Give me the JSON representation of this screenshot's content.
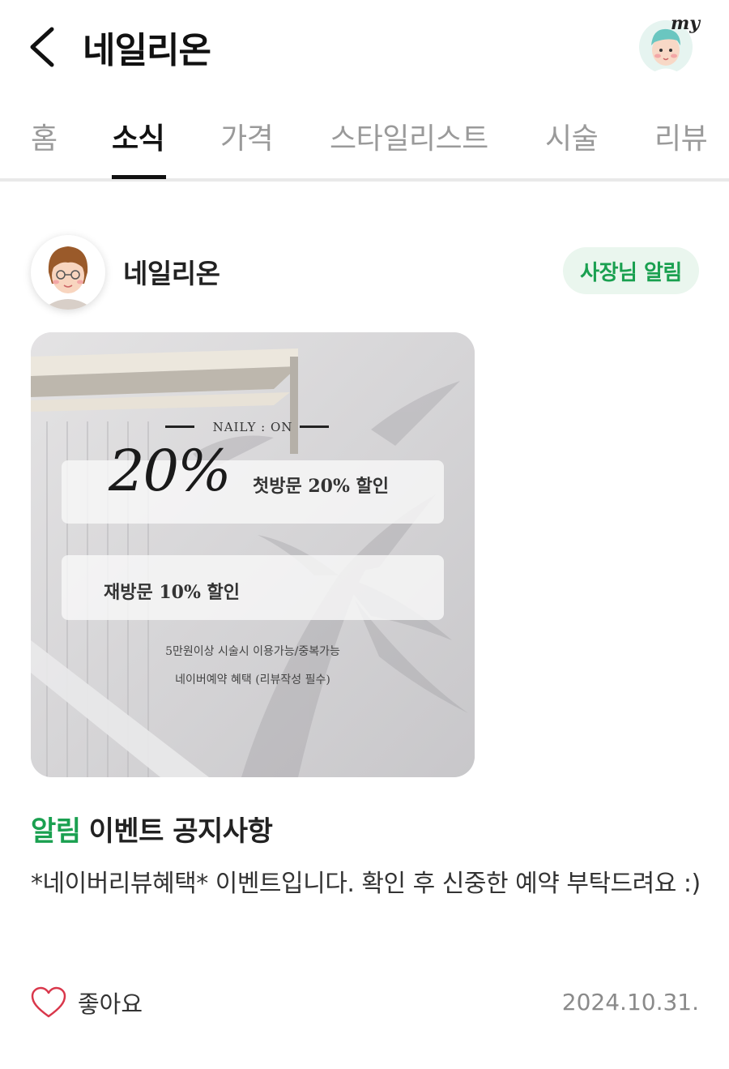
{
  "header": {
    "title": "네일리온",
    "my_badge": "my"
  },
  "tabs": [
    {
      "label": "홈",
      "active": false
    },
    {
      "label": "소식",
      "active": true
    },
    {
      "label": "가격",
      "active": false
    },
    {
      "label": "스타일리스트",
      "active": false
    },
    {
      "label": "시술",
      "active": false
    },
    {
      "label": "리뷰",
      "active": false
    }
  ],
  "post": {
    "author": "네일리온",
    "badge": "사장님 알림",
    "image": {
      "brand": "NAILY : ON",
      "big_percent": "20%",
      "first_visit": "첫방문 20% 할인",
      "revisit": "재방문 10% 할인",
      "note1": "5만원이상 시술시 이용가능/중복가능",
      "note2": "네이버예약 혜택 (리뷰작성 필수)"
    },
    "title_tag": "알림",
    "title": "이벤트 공지사항",
    "text": "*네이버리뷰혜택* 이벤트입니다. 확인 후 신중한 예약 부탁드려요 :)",
    "like_label": "좋아요",
    "date": "2024.10.31."
  },
  "colors": {
    "accent_green": "#1aa050",
    "badge_bg": "#eaf6ee",
    "tab_inactive": "#9a9a9a"
  }
}
